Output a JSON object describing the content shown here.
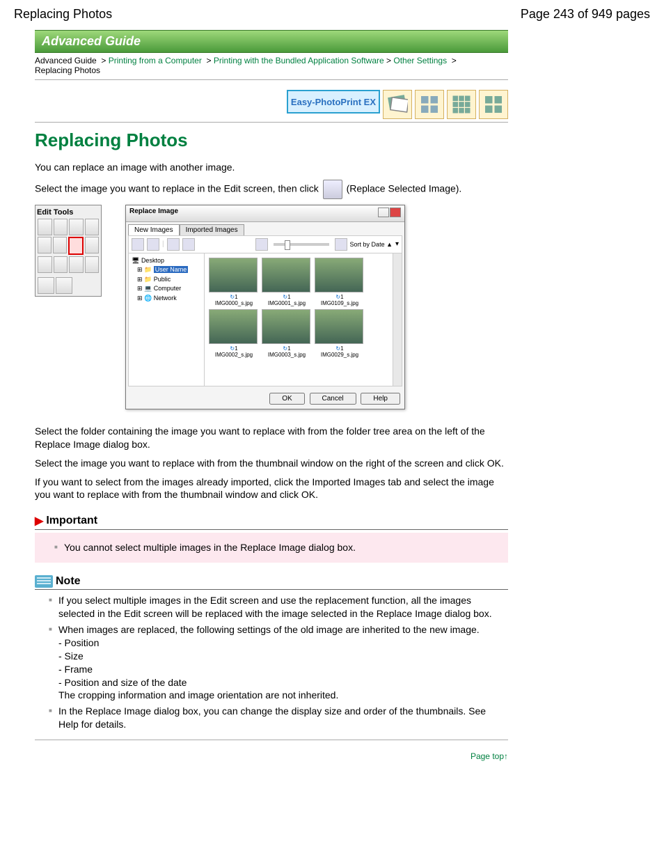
{
  "header": {
    "title": "Replacing Photos",
    "page_info": "Page 243 of 949 pages"
  },
  "guide_header": "Advanced Guide",
  "breadcrumb": {
    "items": [
      "Advanced Guide",
      "Printing from a Computer",
      "Printing with the Bundled Application Software",
      "Other Settings"
    ],
    "current": "Replacing Photos",
    "sep": ">"
  },
  "logo": "Easy-PhotoPrint EX",
  "main_title": "Replacing Photos",
  "intro": "You can replace an image with another image.",
  "instr1a": "Select the image you want to replace in the Edit screen, then click ",
  "instr1b": " (Replace Selected Image).",
  "edit_tools_title": "Edit Tools",
  "dialog": {
    "title": "Replace Image",
    "tabs": [
      "New Images",
      "Imported Images"
    ],
    "sort_label": "Sort by Date ▲",
    "tree": {
      "root": "Desktop",
      "selected": "User Name",
      "siblings": [
        "Public",
        "Computer",
        "Network"
      ]
    },
    "thumbs": [
      "IMG0000_s.jpg",
      "IMG0001_s.jpg",
      "IMG0109_s.jpg",
      "IMG0002_s.jpg",
      "IMG0003_s.jpg",
      "IMG0029_s.jpg"
    ],
    "rotate_badge": "1",
    "buttons": {
      "ok": "OK",
      "cancel": "Cancel",
      "help": "Help"
    }
  },
  "para2": "Select the folder containing the image you want to replace with from the folder tree area on the left of the Replace Image dialog box.",
  "para3": "Select the image you want to replace with from the thumbnail window on the right of the screen and click OK.",
  "para4": "If you want to select from the images already imported, click the Imported Images tab and select the image you want to replace with from the thumbnail window and click OK.",
  "important": {
    "heading": "Important",
    "item": "You cannot select multiple images in the Replace Image dialog box."
  },
  "note": {
    "heading": "Note",
    "items": [
      "If you select multiple images in the Edit screen and use the replacement function, all the images selected in the Edit screen will be replaced with the image selected in the Replace Image dialog box.",
      "When images are replaced, the following settings of the old image are inherited to the new image.",
      "In the Replace Image dialog box, you can change the display size and order of the thumbnails. See Help for details."
    ],
    "sub": [
      "- Position",
      "- Size",
      "- Frame",
      "- Position and size of the date",
      "The cropping information and image orientation are not inherited."
    ]
  },
  "pagetop": "Page top"
}
